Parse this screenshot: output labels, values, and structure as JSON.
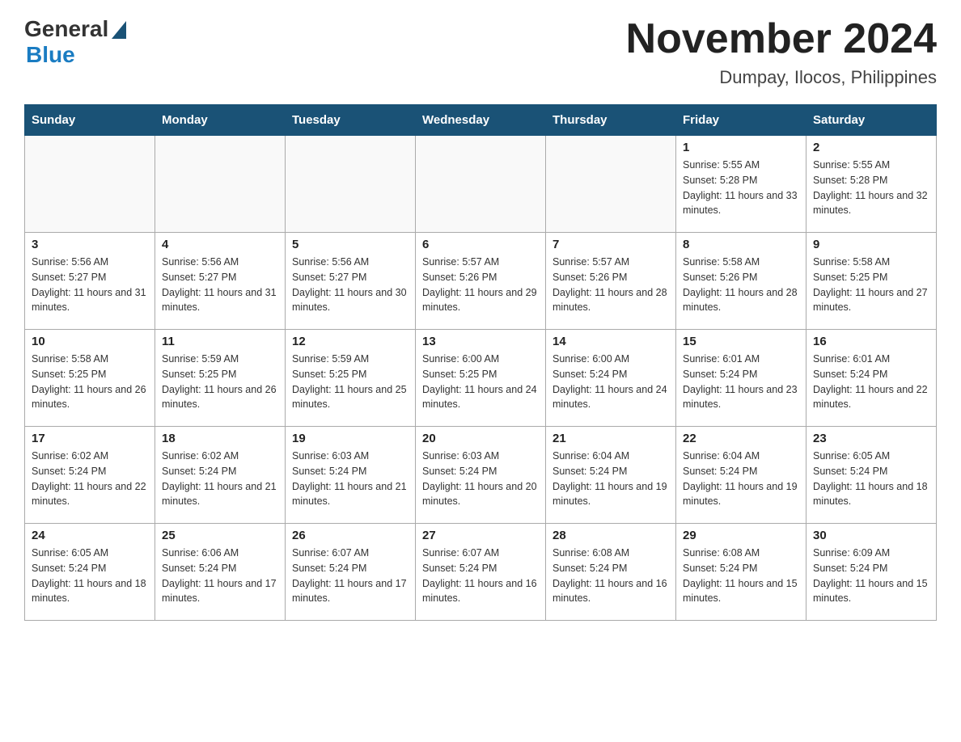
{
  "header": {
    "logo_general": "General",
    "logo_blue": "Blue",
    "month_title": "November 2024",
    "location": "Dumpay, Ilocos, Philippines"
  },
  "calendar": {
    "days_of_week": [
      "Sunday",
      "Monday",
      "Tuesday",
      "Wednesday",
      "Thursday",
      "Friday",
      "Saturday"
    ],
    "weeks": [
      [
        {
          "day": "",
          "sunrise": "",
          "sunset": "",
          "daylight": ""
        },
        {
          "day": "",
          "sunrise": "",
          "sunset": "",
          "daylight": ""
        },
        {
          "day": "",
          "sunrise": "",
          "sunset": "",
          "daylight": ""
        },
        {
          "day": "",
          "sunrise": "",
          "sunset": "",
          "daylight": ""
        },
        {
          "day": "",
          "sunrise": "",
          "sunset": "",
          "daylight": ""
        },
        {
          "day": "1",
          "sunrise": "Sunrise: 5:55 AM",
          "sunset": "Sunset: 5:28 PM",
          "daylight": "Daylight: 11 hours and 33 minutes."
        },
        {
          "day": "2",
          "sunrise": "Sunrise: 5:55 AM",
          "sunset": "Sunset: 5:28 PM",
          "daylight": "Daylight: 11 hours and 32 minutes."
        }
      ],
      [
        {
          "day": "3",
          "sunrise": "Sunrise: 5:56 AM",
          "sunset": "Sunset: 5:27 PM",
          "daylight": "Daylight: 11 hours and 31 minutes."
        },
        {
          "day": "4",
          "sunrise": "Sunrise: 5:56 AM",
          "sunset": "Sunset: 5:27 PM",
          "daylight": "Daylight: 11 hours and 31 minutes."
        },
        {
          "day": "5",
          "sunrise": "Sunrise: 5:56 AM",
          "sunset": "Sunset: 5:27 PM",
          "daylight": "Daylight: 11 hours and 30 minutes."
        },
        {
          "day": "6",
          "sunrise": "Sunrise: 5:57 AM",
          "sunset": "Sunset: 5:26 PM",
          "daylight": "Daylight: 11 hours and 29 minutes."
        },
        {
          "day": "7",
          "sunrise": "Sunrise: 5:57 AM",
          "sunset": "Sunset: 5:26 PM",
          "daylight": "Daylight: 11 hours and 28 minutes."
        },
        {
          "day": "8",
          "sunrise": "Sunrise: 5:58 AM",
          "sunset": "Sunset: 5:26 PM",
          "daylight": "Daylight: 11 hours and 28 minutes."
        },
        {
          "day": "9",
          "sunrise": "Sunrise: 5:58 AM",
          "sunset": "Sunset: 5:25 PM",
          "daylight": "Daylight: 11 hours and 27 minutes."
        }
      ],
      [
        {
          "day": "10",
          "sunrise": "Sunrise: 5:58 AM",
          "sunset": "Sunset: 5:25 PM",
          "daylight": "Daylight: 11 hours and 26 minutes."
        },
        {
          "day": "11",
          "sunrise": "Sunrise: 5:59 AM",
          "sunset": "Sunset: 5:25 PM",
          "daylight": "Daylight: 11 hours and 26 minutes."
        },
        {
          "day": "12",
          "sunrise": "Sunrise: 5:59 AM",
          "sunset": "Sunset: 5:25 PM",
          "daylight": "Daylight: 11 hours and 25 minutes."
        },
        {
          "day": "13",
          "sunrise": "Sunrise: 6:00 AM",
          "sunset": "Sunset: 5:25 PM",
          "daylight": "Daylight: 11 hours and 24 minutes."
        },
        {
          "day": "14",
          "sunrise": "Sunrise: 6:00 AM",
          "sunset": "Sunset: 5:24 PM",
          "daylight": "Daylight: 11 hours and 24 minutes."
        },
        {
          "day": "15",
          "sunrise": "Sunrise: 6:01 AM",
          "sunset": "Sunset: 5:24 PM",
          "daylight": "Daylight: 11 hours and 23 minutes."
        },
        {
          "day": "16",
          "sunrise": "Sunrise: 6:01 AM",
          "sunset": "Sunset: 5:24 PM",
          "daylight": "Daylight: 11 hours and 22 minutes."
        }
      ],
      [
        {
          "day": "17",
          "sunrise": "Sunrise: 6:02 AM",
          "sunset": "Sunset: 5:24 PM",
          "daylight": "Daylight: 11 hours and 22 minutes."
        },
        {
          "day": "18",
          "sunrise": "Sunrise: 6:02 AM",
          "sunset": "Sunset: 5:24 PM",
          "daylight": "Daylight: 11 hours and 21 minutes."
        },
        {
          "day": "19",
          "sunrise": "Sunrise: 6:03 AM",
          "sunset": "Sunset: 5:24 PM",
          "daylight": "Daylight: 11 hours and 21 minutes."
        },
        {
          "day": "20",
          "sunrise": "Sunrise: 6:03 AM",
          "sunset": "Sunset: 5:24 PM",
          "daylight": "Daylight: 11 hours and 20 minutes."
        },
        {
          "day": "21",
          "sunrise": "Sunrise: 6:04 AM",
          "sunset": "Sunset: 5:24 PM",
          "daylight": "Daylight: 11 hours and 19 minutes."
        },
        {
          "day": "22",
          "sunrise": "Sunrise: 6:04 AM",
          "sunset": "Sunset: 5:24 PM",
          "daylight": "Daylight: 11 hours and 19 minutes."
        },
        {
          "day": "23",
          "sunrise": "Sunrise: 6:05 AM",
          "sunset": "Sunset: 5:24 PM",
          "daylight": "Daylight: 11 hours and 18 minutes."
        }
      ],
      [
        {
          "day": "24",
          "sunrise": "Sunrise: 6:05 AM",
          "sunset": "Sunset: 5:24 PM",
          "daylight": "Daylight: 11 hours and 18 minutes."
        },
        {
          "day": "25",
          "sunrise": "Sunrise: 6:06 AM",
          "sunset": "Sunset: 5:24 PM",
          "daylight": "Daylight: 11 hours and 17 minutes."
        },
        {
          "day": "26",
          "sunrise": "Sunrise: 6:07 AM",
          "sunset": "Sunset: 5:24 PM",
          "daylight": "Daylight: 11 hours and 17 minutes."
        },
        {
          "day": "27",
          "sunrise": "Sunrise: 6:07 AM",
          "sunset": "Sunset: 5:24 PM",
          "daylight": "Daylight: 11 hours and 16 minutes."
        },
        {
          "day": "28",
          "sunrise": "Sunrise: 6:08 AM",
          "sunset": "Sunset: 5:24 PM",
          "daylight": "Daylight: 11 hours and 16 minutes."
        },
        {
          "day": "29",
          "sunrise": "Sunrise: 6:08 AM",
          "sunset": "Sunset: 5:24 PM",
          "daylight": "Daylight: 11 hours and 15 minutes."
        },
        {
          "day": "30",
          "sunrise": "Sunrise: 6:09 AM",
          "sunset": "Sunset: 5:24 PM",
          "daylight": "Daylight: 11 hours and 15 minutes."
        }
      ]
    ]
  }
}
